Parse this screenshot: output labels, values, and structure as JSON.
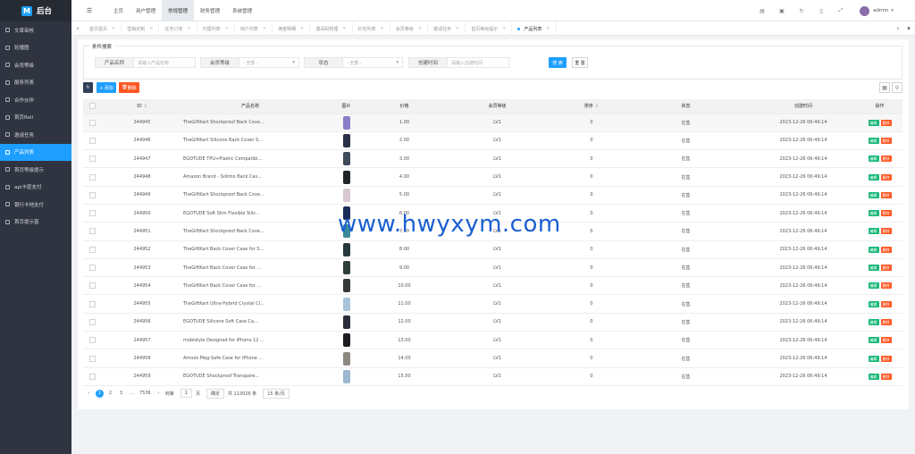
{
  "app": {
    "logo_letter": "M",
    "title": "后台"
  },
  "sidebar": {
    "items": [
      {
        "label": "文章审核"
      },
      {
        "label": "轮播图"
      },
      {
        "label": "会员等级"
      },
      {
        "label": "服务列表"
      },
      {
        "label": "合作伙伴"
      },
      {
        "label": "首页Roll"
      },
      {
        "label": "邀请任务"
      },
      {
        "label": "产品列表"
      },
      {
        "label": "首页等级提示"
      },
      {
        "label": "api卡密支付"
      },
      {
        "label": "银行卡地支付"
      },
      {
        "label": "首页提示窗"
      }
    ],
    "active_index": 7
  },
  "topnav": {
    "items": [
      {
        "label": "主页"
      },
      {
        "label": "用户管理"
      },
      {
        "label": "常规管理"
      },
      {
        "label": "财务管理"
      },
      {
        "label": "系统管理"
      }
    ],
    "active_index": 2,
    "user": "admin"
  },
  "tabs": [
    {
      "label": "首页首页"
    },
    {
      "label": "营销定制"
    },
    {
      "label": "任务订单"
    },
    {
      "label": "代理列表"
    },
    {
      "label": "用户列表"
    },
    {
      "label": "佣金明细"
    },
    {
      "label": "邀请码管理"
    },
    {
      "label": "红包列表"
    },
    {
      "label": "会员等级"
    },
    {
      "label": "邀请任务"
    },
    {
      "label": "首页等级提示"
    },
    {
      "label": "产品列表"
    }
  ],
  "search": {
    "legend": "条件搜索",
    "name_label": "产品名称",
    "name_placeholder": "请输入产品名称",
    "level_label": "会员等级",
    "level_value": "- 全部 -",
    "status_label": "状态",
    "status_value": "- 全部 -",
    "created_label": "创建时间",
    "created_placeholder": "请输入创建时间",
    "search_btn": "搜 索",
    "reset_btn": "重 置"
  },
  "toolbar": {
    "add_label": "+ 添加",
    "delete_label": "删除"
  },
  "table": {
    "headers": [
      "ID",
      "产品名称",
      "图片",
      "价格",
      "会员等级",
      "排序",
      "状态",
      "创建时间",
      "操作"
    ],
    "edit_label": "编辑",
    "delete_label": "删除",
    "rows": [
      {
        "id": "244945",
        "name": "TheGiftKart Shockproof Back Cove...",
        "price": "1.00",
        "level": "LV1",
        "sort": "0",
        "status": "在售",
        "created": "2023-12-26 06:49:14",
        "img": "#8a7fc8"
      },
      {
        "id": "244946",
        "name": "TheGiftKart Silicone Back Cover S...",
        "price": "2.00",
        "level": "LV1",
        "sort": "0",
        "status": "在售",
        "created": "2023-12-26 06:49:14",
        "img": "#2b2f45"
      },
      {
        "id": "244947",
        "name": "EGOTUDE TPU+Plastic Compatibl...",
        "price": "3.00",
        "level": "LV1",
        "sort": "0",
        "status": "在售",
        "created": "2023-12-26 06:49:14",
        "img": "#3c4a5a"
      },
      {
        "id": "244948",
        "name": "Amazon Brand - Solimo Back Cas...",
        "price": "4.00",
        "level": "LV1",
        "sort": "0",
        "status": "在售",
        "created": "2023-12-26 06:49:14",
        "img": "#1f2426"
      },
      {
        "id": "244949",
        "name": "TheGiftKart Shockproof Back Cove...",
        "price": "5.00",
        "level": "LV1",
        "sort": "0",
        "status": "在售",
        "created": "2023-12-26 06:49:14",
        "img": "#d8c7d0"
      },
      {
        "id": "244950",
        "name": "EGOTUDE Soft Slim Flexible Silic...",
        "price": "6.00",
        "level": "LV1",
        "sort": "0",
        "status": "在售",
        "created": "2023-12-26 06:49:14",
        "img": "#1c2c5a"
      },
      {
        "id": "244951",
        "name": "TheGiftKart Shockproof Back Cove...",
        "price": "7.00",
        "level": "LV1",
        "sort": "0",
        "status": "在售",
        "created": "2023-12-26 06:49:14",
        "img": "#3b8a9a"
      },
      {
        "id": "244952",
        "name": "TheGiftKart Back Cover Case for S...",
        "price": "8.00",
        "level": "LV1",
        "sort": "0",
        "status": "在售",
        "created": "2023-12-26 06:49:14",
        "img": "#263a3e"
      },
      {
        "id": "244953",
        "name": "TheGiftKart Back Cover Case for ...",
        "price": "9.00",
        "level": "LV1",
        "sort": "0",
        "status": "在售",
        "created": "2023-12-26 06:49:14",
        "img": "#2e3f3a"
      },
      {
        "id": "244954",
        "name": "TheGiftKart Back Cover Case for ...",
        "price": "10.00",
        "level": "LV1",
        "sort": "0",
        "status": "在售",
        "created": "2023-12-26 06:49:14",
        "img": "#343838"
      },
      {
        "id": "244955",
        "name": "TheGiftKart Ultra-Hybrid Crystal Cl...",
        "price": "11.00",
        "level": "LV1",
        "sort": "0",
        "status": "在售",
        "created": "2023-12-26 06:49:14",
        "img": "#a9c4d8"
      },
      {
        "id": "244956",
        "name": "EGOTUDE Silicone Soft Case Ca...",
        "price": "12.00",
        "level": "LV1",
        "sort": "0",
        "status": "在售",
        "created": "2023-12-26 06:49:14",
        "img": "#2a2d3a"
      },
      {
        "id": "244957",
        "name": "mobistyle Designed for iPhone 12 ...",
        "price": "13.00",
        "level": "LV1",
        "sort": "0",
        "status": "在售",
        "created": "2023-12-26 06:49:14",
        "img": "#1a1c20"
      },
      {
        "id": "244958",
        "name": "Amozo Mag-Safe Case for iPhone ...",
        "price": "14.00",
        "level": "LV1",
        "sort": "0",
        "status": "在售",
        "created": "2023-12-26 06:49:14",
        "img": "#8c8a80"
      },
      {
        "id": "244959",
        "name": "EGOTUDE Shockproof Transpare...",
        "price": "15.00",
        "level": "LV1",
        "sort": "0",
        "status": "在售",
        "created": "2023-12-26 06:49:14",
        "img": "#9db8d0"
      }
    ]
  },
  "pager": {
    "pages": [
      "1",
      "2",
      "3",
      "...",
      "7536"
    ],
    "goto_label": "到第",
    "current_input": "1",
    "page_unit": "页",
    "confirm_label": "确定",
    "total": "共 113026 条",
    "per_page": "15 条/页"
  },
  "watermark": "www.hwyxym.com"
}
